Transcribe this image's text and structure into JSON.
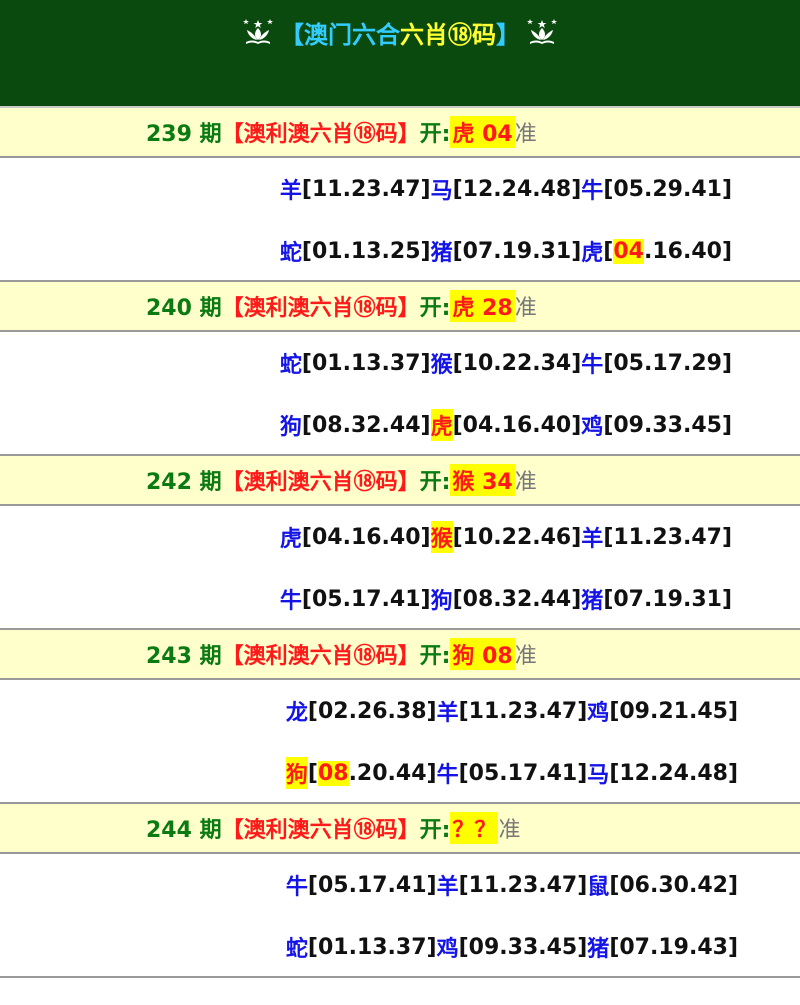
{
  "header": {
    "title_open": "【",
    "title_main": "澳门六合",
    "title_hl": "六肖⑱码",
    "title_close": "】",
    "icon_left": "macau-lotus-icon",
    "icon_right": "macau-lotus-icon"
  },
  "colors": {
    "header_bg": "#0a4a0e",
    "period_bg": "#ffffcc",
    "highlight_bg": "#ffff00",
    "zodiac": "#1414e6",
    "red": "#ff1a1a",
    "green": "#0b7a12"
  },
  "labels": {
    "qi": "期",
    "name": "【澳利澳六肖⑱码】",
    "open": "开:",
    "zhun": "准"
  },
  "periods": [
    {
      "num": "239",
      "result": "虎 04",
      "lines": [
        [
          {
            "z": "羊",
            "n": "11.23.47"
          },
          {
            "z": "马",
            "n": "12.24.48"
          },
          {
            "z": "牛",
            "n": "05.29.41"
          }
        ],
        [
          {
            "z": "蛇",
            "n": "01.13.25"
          },
          {
            "z": "猪",
            "n": "07.19.31"
          },
          {
            "z": "虎",
            "n": "04.16.40",
            "hit": "04"
          }
        ]
      ]
    },
    {
      "num": "240",
      "result": "虎 28",
      "lines": [
        [
          {
            "z": "蛇",
            "n": "01.13.37"
          },
          {
            "z": "猴",
            "n": "10.22.34"
          },
          {
            "z": "牛",
            "n": "05.17.29"
          }
        ],
        [
          {
            "z": "狗",
            "n": "08.32.44"
          },
          {
            "z": "虎",
            "n": "04.16.40",
            "zhit": true
          },
          {
            "z": "鸡",
            "n": "09.33.45"
          }
        ]
      ]
    },
    {
      "num": "242",
      "result": "猴 34",
      "lines": [
        [
          {
            "z": "虎",
            "n": "04.16.40"
          },
          {
            "z": "猴",
            "n": "10.22.46",
            "zhit": true
          },
          {
            "z": "羊",
            "n": "11.23.47"
          }
        ],
        [
          {
            "z": "牛",
            "n": "05.17.41"
          },
          {
            "z": "狗",
            "n": "08.32.44"
          },
          {
            "z": "猪",
            "n": "07.19.31"
          }
        ]
      ]
    },
    {
      "num": "243",
      "result": "狗 08",
      "lines": [
        [
          {
            "z": "龙",
            "n": "02.26.38"
          },
          {
            "z": "羊",
            "n": "11.23.47"
          },
          {
            "z": "鸡",
            "n": "09.21.45"
          }
        ],
        [
          {
            "z": "狗",
            "n": "08.20.44",
            "zhit": true,
            "hit": "08"
          },
          {
            "z": "牛",
            "n": "05.17.41"
          },
          {
            "z": "马",
            "n": "12.24.48"
          }
        ]
      ]
    },
    {
      "num": "244",
      "result": "？？",
      "lines": [
        [
          {
            "z": "牛",
            "n": "05.17.41"
          },
          {
            "z": "羊",
            "n": "11.23.47"
          },
          {
            "z": "鼠",
            "n": "06.30.42"
          }
        ],
        [
          {
            "z": "蛇",
            "n": "01.13.37"
          },
          {
            "z": "鸡",
            "n": "09.33.45"
          },
          {
            "z": "猪",
            "n": "07.19.43"
          }
        ]
      ]
    }
  ]
}
